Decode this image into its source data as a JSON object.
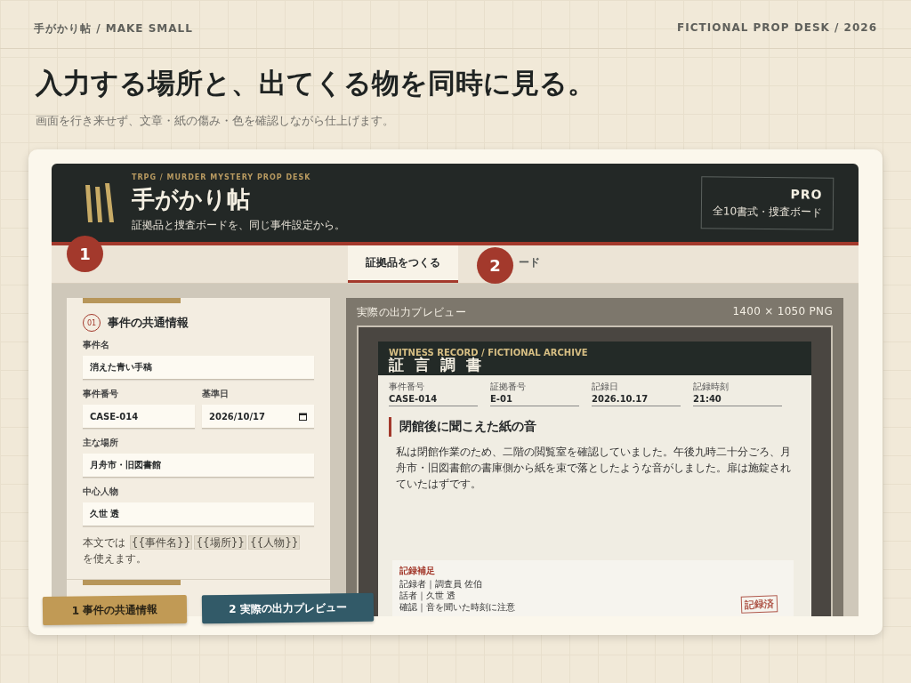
{
  "topbar": {
    "left": "手がかり帖 / MAKE SMALL",
    "right": "FICTIONAL PROP DESK / 2026"
  },
  "hero": {
    "title": "入力する場所と、出てくる物を同時に見る。",
    "subtitle": "画面を行き来せず、文章・紙の傷み・色を確認しながら仕上げます。"
  },
  "app": {
    "eyebrow": "TRPG / MURDER MYSTERY PROP DESK",
    "title": "手がかり帖",
    "subtitle": "証拠品と捜査ボードを、同じ事件設定から。",
    "plan": {
      "name": "PRO",
      "detail": "全10書式・捜査ボード"
    }
  },
  "tabs": [
    {
      "label": "証拠品をつくる",
      "selected": true
    },
    {
      "label": "ード",
      "selected": false
    }
  ],
  "form": {
    "number": "01",
    "title": "事件の共通情報",
    "rows": [
      [
        {
          "label": "事件名",
          "value": "消えた青い手稿",
          "kind": "text"
        }
      ],
      [
        {
          "label": "事件番号",
          "value": "CASE-014",
          "kind": "text"
        },
        {
          "label": "基準日",
          "value": "2026/10/17",
          "kind": "date"
        }
      ],
      [
        {
          "label": "主な場所",
          "value": "月舟市・旧図書館",
          "kind": "text"
        }
      ],
      [
        {
          "label": "中心人物",
          "value": "久世 透",
          "kind": "text"
        }
      ]
    ],
    "hint": {
      "before": "本文では",
      "tokens": [
        "{{事件名}}",
        "{{場所}}",
        "{{人物}}"
      ],
      "after": "を使えます。"
    }
  },
  "preview": {
    "label": "実際の出力プレビュー",
    "size": "1400 × 1050 PNG",
    "document": {
      "eyebrow": "WITNESS RECORD / FICTIONAL ARCHIVE",
      "title": "証 言 調 書",
      "meta": [
        {
          "label": "事件番号",
          "value": "CASE-014"
        },
        {
          "label": "証拠番号",
          "value": "E-01"
        },
        {
          "label": "記録日",
          "value": "2026.10.17"
        },
        {
          "label": "記録時刻",
          "value": "21:40"
        }
      ],
      "heading": "閉館後に聞こえた紙の音",
      "body": "私は閉館作業のため、二階の閲覧室を確認していました。午後九時二十分ごろ、月舟市・旧図書館の書庫側から紙を束で落としたような音がしました。扉は施錠されていたはずです。",
      "note": {
        "title": "記録補足",
        "lines": [
          "記録者｜調査員 佐伯",
          "話者｜久世 透",
          "確認｜音を聞いた時刻に注意"
        ]
      },
      "stamp": "記録済"
    }
  },
  "markers": [
    "1",
    "2"
  ],
  "callouts": [
    {
      "label": "1 事件の共通情報",
      "color": "#c19a55"
    },
    {
      "label": "2 実際の出力プレビュー",
      "color": "#325a68"
    }
  ]
}
